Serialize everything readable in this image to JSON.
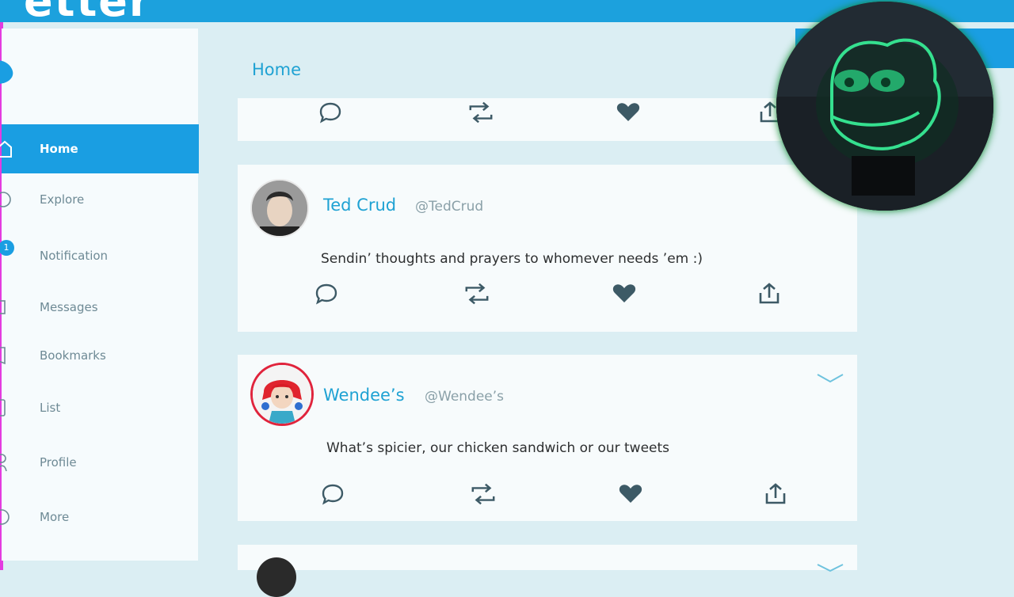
{
  "app": {
    "logo_text": "etter"
  },
  "header": {
    "title": "Home"
  },
  "sidebar": {
    "items": [
      {
        "label": "Home",
        "active": true,
        "icon": "home-icon"
      },
      {
        "label": "Explore",
        "active": false,
        "icon": "explore-icon"
      },
      {
        "label": "Notification",
        "active": false,
        "icon": "notification-icon",
        "badge": "1"
      },
      {
        "label": "Messages",
        "active": false,
        "icon": "messages-icon"
      },
      {
        "label": "Bookmarks",
        "active": false,
        "icon": "bookmarks-icon"
      },
      {
        "label": "List",
        "active": false,
        "icon": "list-icon"
      },
      {
        "label": "Profile",
        "active": false,
        "icon": "profile-icon"
      },
      {
        "label": "More",
        "active": false,
        "icon": "more-icon"
      }
    ]
  },
  "tweets": [
    {
      "name": "Ted Crud",
      "handle": "@TedCrud",
      "text": "Sendin’ thoughts and prayers to whomever needs ’em :)"
    },
    {
      "name": "Wendee’s",
      "handle": "@Wendee’s",
      "text": "What’s spicier, our chicken sandwich or our tweets"
    }
  ],
  "colors": {
    "accent": "#1a9ee2",
    "link": "#1fa2d3",
    "background": "#dbeef3",
    "card": "#f7fbfc"
  },
  "icons": [
    "reply-icon",
    "retweet-icon",
    "like-icon",
    "share-icon",
    "chevron-down-icon",
    "bird-logo-icon"
  ]
}
